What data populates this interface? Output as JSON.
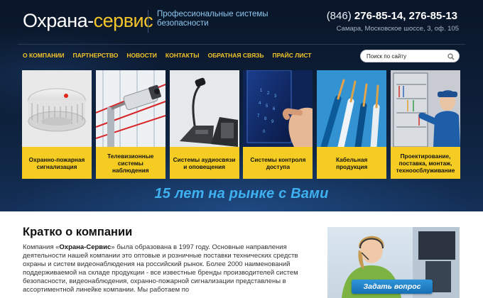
{
  "header": {
    "logo_main": "Охрана-",
    "logo_accent": "сервис",
    "tagline": "Профессиональные системы безопасности",
    "phone_code": "(846)",
    "phone_numbers": "276-85-14, 276-85-13",
    "address": "Самара, Московское шоссе, 3, оф. 105"
  },
  "nav": {
    "items": [
      {
        "label": "О компании"
      },
      {
        "label": "Партнерство"
      },
      {
        "label": "Новости"
      },
      {
        "label": "Контакты"
      },
      {
        "label": "Обратная связь"
      },
      {
        "label": "Прайс лист"
      }
    ]
  },
  "search": {
    "placeholder": "Поиск по сайту"
  },
  "categories": [
    {
      "label": "Охранно-пожарная сигнализация",
      "icon": "smoke-detector"
    },
    {
      "label": "Телевизионные системы наблюдения",
      "icon": "cctv-camera"
    },
    {
      "label": "Системы аудиосвязи и оповещения",
      "icon": "microphone"
    },
    {
      "label": "Системы контроля доступа",
      "icon": "keypad"
    },
    {
      "label": "Кабельная продукция",
      "icon": "cables"
    },
    {
      "label": "Проектирование, поставка, монтаж, техноосблуживание",
      "icon": "technician"
    }
  ],
  "slogan": "15 лет на рынке с Вами",
  "about": {
    "title": "Кратко о компании",
    "text_prefix": "Компания «",
    "company": "Охрана-Сервис",
    "text_body": "» была образована в 1997 году. Основные направления деятельности нашей компании это оптовые и розничные поставки технических средств охраны и систем видеонаблюдения на российский рынок. Более 2000 наименований поддерживаемой на складе продукции - все известные бренды производителей систем безопасности, видеонаблюдения, охранно-пожарной сигнализации представлены в ассортиментной линейке компании. Мы работаем по"
  },
  "support": {
    "button_label": "Задать вопрос"
  },
  "colors": {
    "accent_yellow": "#f5cd22",
    "nav_yellow": "#f4c52a",
    "slogan_blue": "#3fb0f0",
    "header_dark": "#0d1e37",
    "button_blue": "#1f82c8"
  }
}
